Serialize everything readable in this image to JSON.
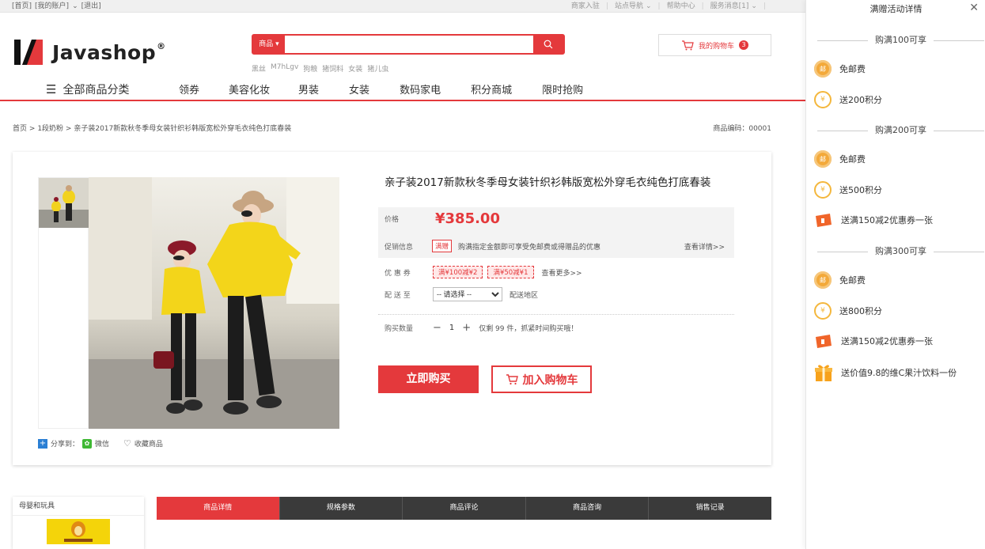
{
  "topbar": {
    "left_links": [
      "[首页]",
      "[我的账户]",
      "[退出]"
    ],
    "right_links": [
      "商家入驻",
      "站点导航",
      "帮助中心",
      "服务消息[1]"
    ]
  },
  "logo": {
    "text": "Javashop",
    "reg": "®"
  },
  "search": {
    "category": "商品",
    "value": "",
    "placeholder": ""
  },
  "hot_words": [
    "黑丝",
    "M7hLgv",
    "狗粮",
    "猪饲料",
    "女装",
    "猪儿虫"
  ],
  "cart": {
    "label": "我的购物车",
    "count": "3"
  },
  "nav": {
    "all_categories": "全部商品分类",
    "items": [
      "领券",
      "美容化妆",
      "男装",
      "女装",
      "数码家电",
      "积分商城",
      "限时抢购"
    ]
  },
  "breadcrumb": {
    "items": [
      "首页",
      "1段奶粉",
      "亲子装2017新款秋冬季母女装针织衫韩版宽松外穿毛衣纯色打底春装"
    ],
    "sep": ">"
  },
  "sku": {
    "label": "商品编码：",
    "value": "00001"
  },
  "product": {
    "title": "亲子装2017新款秋冬季母女装针织衫韩版宽松外穿毛衣纯色打底春装",
    "price_label": "价格",
    "price": "¥385.00",
    "promo_label": "促销信息",
    "promo_tag": "满赠",
    "promo_text": "购满指定金额即可享受免邮费或得赠品的优惠",
    "promo_more": "查看详情>>",
    "coupon_label": "优 惠 券",
    "coupons": [
      "满¥100减¥2",
      "满¥50减¥1"
    ],
    "coupon_more": "查看更多>>",
    "ship_label": "配 送 至",
    "ship_select": "-- 请选择 --",
    "ship_area": "配送地区",
    "qty_label": "购买数量",
    "qty_value": "1",
    "stock_text": "仅剩 99 件，抓紧时间购买哦！",
    "buy_now": "立即购买",
    "add_cart": "加入购物车"
  },
  "share": {
    "label": "分享到：",
    "wechat": "微信",
    "favorite": "收藏商品"
  },
  "sidebox": {
    "title": "母婴和玩具"
  },
  "tabs": [
    "商品详情",
    "规格参数",
    "商品评论",
    "商品咨询",
    "销售记录"
  ],
  "panel": {
    "title": "满赠活动详情",
    "tiers": [
      {
        "title": "购满100可享",
        "gifts": [
          {
            "icon": "mail-icon",
            "text": "免邮费"
          },
          {
            "icon": "points-icon",
            "text": "送200积分"
          }
        ]
      },
      {
        "title": "购满200可享",
        "gifts": [
          {
            "icon": "mail-icon",
            "text": "免邮费"
          },
          {
            "icon": "points-icon",
            "text": "送500积分"
          },
          {
            "icon": "coupon-icon",
            "text": "送满150减2优惠券一张"
          }
        ]
      },
      {
        "title": "购满300可享",
        "gifts": [
          {
            "icon": "mail-icon",
            "text": "免邮费"
          },
          {
            "icon": "points-icon",
            "text": "送800积分"
          },
          {
            "icon": "coupon-icon",
            "text": "送满150减2优惠券一张"
          },
          {
            "icon": "gift-icon",
            "text": "送价值9.8的维C果汁饮料一份"
          }
        ]
      }
    ]
  },
  "colors": {
    "accent": "#e4393c",
    "tab_dark": "#3a3a3a"
  }
}
